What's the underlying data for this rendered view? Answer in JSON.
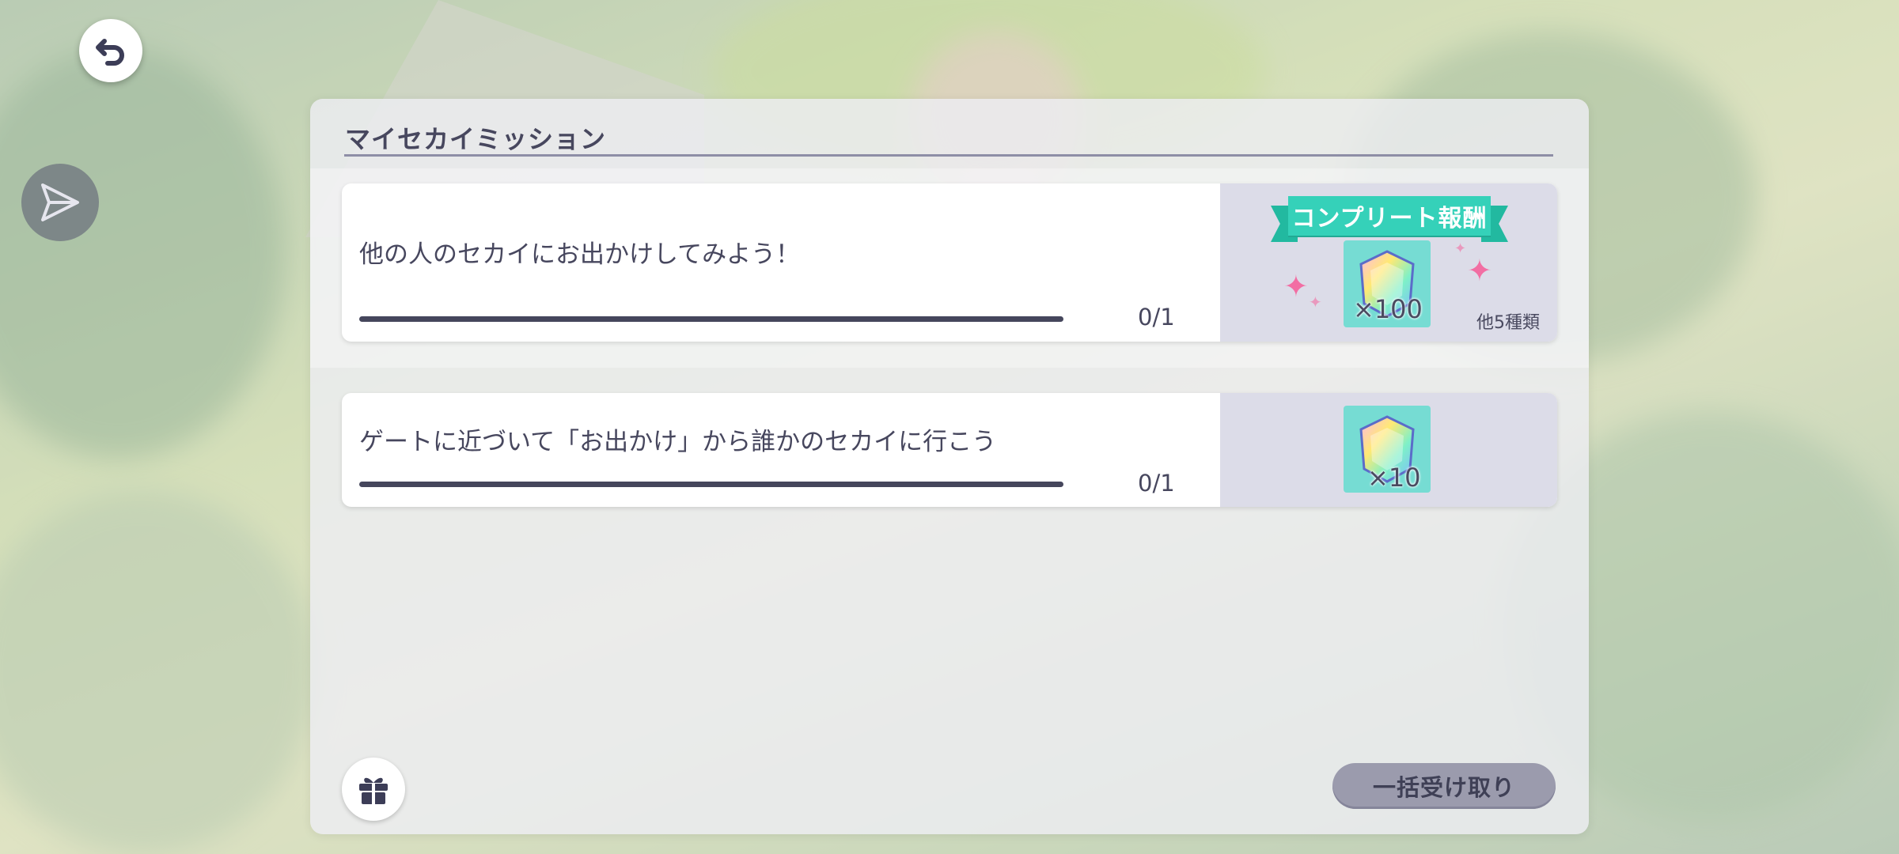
{
  "panel": {
    "title": "マイセカイミッション"
  },
  "missions": [
    {
      "text": "他の人のセカイにお出かけしてみよう！",
      "progress": "0/1",
      "progress_fraction": 0,
      "banner": "コンプリート報酬",
      "reward_icon": "crystal-gem-icon",
      "reward_count": "×100",
      "others": "他5種類"
    },
    {
      "text": "ゲートに近づいて「お出かけ」から誰かのセカイに行こう",
      "progress": "0/1",
      "progress_fraction": 0,
      "reward_icon": "crystal-gem-icon",
      "reward_count": "×10"
    }
  ],
  "buttons": {
    "claim_all": "一括受け取り"
  },
  "icons": {
    "back": "back-arrow-icon",
    "send": "send-arrow-icon",
    "gift": "gift-icon"
  },
  "colors": {
    "accent": "#35d1b9",
    "gem_bg": "#76dcd3",
    "text": "#47475e",
    "spark": "#f26ea3"
  }
}
